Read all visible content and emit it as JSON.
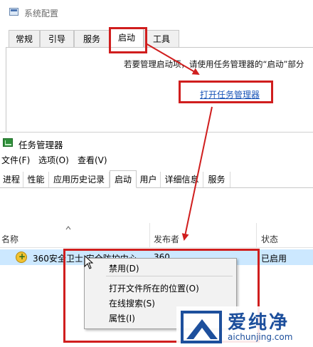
{
  "system_config": {
    "title": "系统配置",
    "tabs": [
      {
        "label": "常规"
      },
      {
        "label": "引导"
      },
      {
        "label": "服务"
      },
      {
        "label": "启动"
      },
      {
        "label": "工具"
      }
    ],
    "active_tab": "启动",
    "hint": "若要管理启动项，请使用任务管理器的“启动”部分",
    "open_task_manager_link": "打开任务管理器"
  },
  "task_manager": {
    "title": "任务管理器",
    "menu": [
      {
        "label": "文件(F)"
      },
      {
        "label": "选项(O)"
      },
      {
        "label": "查看(V)"
      }
    ],
    "tabs": [
      {
        "label": "进程"
      },
      {
        "label": "性能"
      },
      {
        "label": "应用历史记录"
      },
      {
        "label": "启动"
      },
      {
        "label": "用户"
      },
      {
        "label": "详细信息"
      },
      {
        "label": "服务"
      }
    ],
    "active_tab": "启动",
    "columns": {
      "name": "名称",
      "publisher": "发布者",
      "status": "状态"
    },
    "rows": [
      {
        "name": "360安全卫士 安全防护中心",
        "publisher": "360",
        "status": "已启用"
      }
    ],
    "context_menu": [
      {
        "label": "禁用(D)"
      },
      {
        "label": "打开文件所在的位置(O)"
      },
      {
        "label": "在线搜索(S)"
      },
      {
        "label": "属性(I)"
      }
    ]
  },
  "watermark": {
    "name": "爱纯净",
    "url": "aichunjing.com"
  },
  "colors": {
    "highlight": "#d01e1e",
    "link": "#1a55b8",
    "selected_row": "#cce8ff",
    "watermark": "#1d4f9c"
  }
}
